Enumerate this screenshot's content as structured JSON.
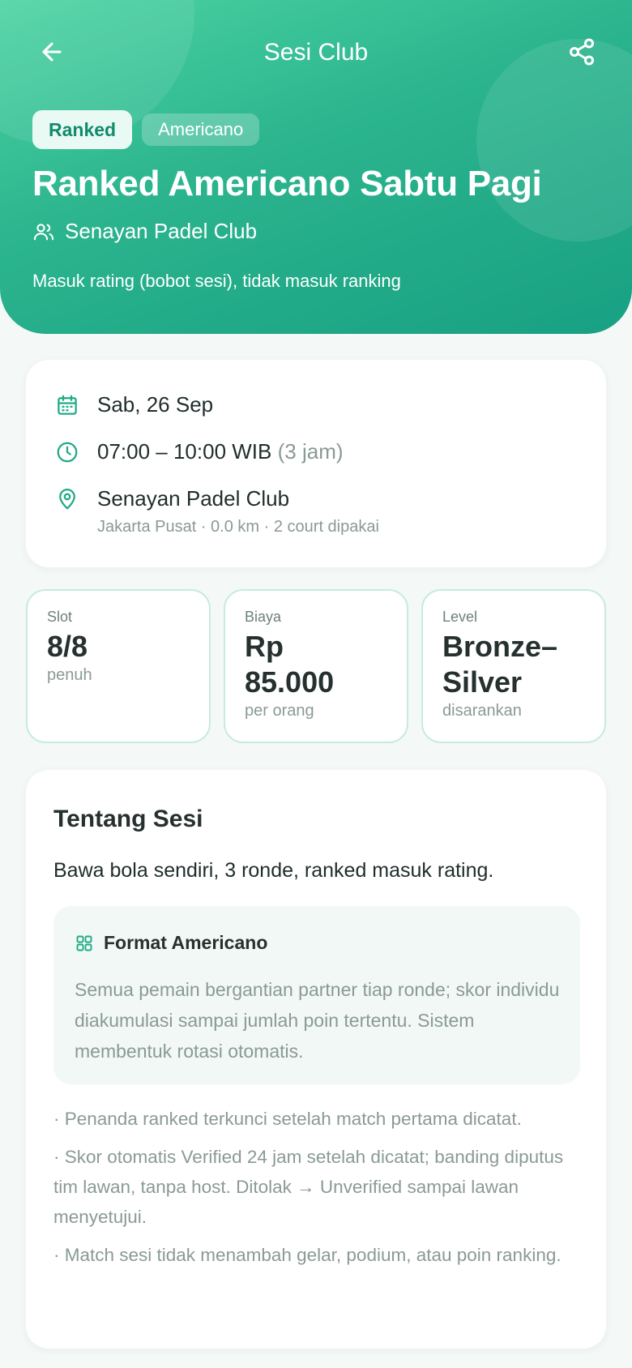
{
  "header": {
    "title": "Sesi Club",
    "badges": {
      "ranked": "Ranked",
      "format": "Americano"
    },
    "session_title": "Ranked Americano Sabtu Pagi",
    "club_name": "Senayan Padel Club",
    "rating_note": "Masuk rating (bobot sesi), tidak masuk ranking"
  },
  "details": {
    "date": "Sab, 26 Sep",
    "time": "07:00 – 10:00 WIB",
    "duration": "(3 jam)",
    "venue": "Senayan Padel Club",
    "venue_sub": "Jakarta Pusat · 0.0 km · 2 court dipakai"
  },
  "stats": {
    "slot": {
      "label": "Slot",
      "value": "8/8",
      "sub": "penuh"
    },
    "cost": {
      "label": "Biaya",
      "value_line1": "Rp",
      "value_line2": "85.000",
      "sub": "per orang"
    },
    "level": {
      "label": "Level",
      "value_line1": "Bronze–",
      "value_line2": "Silver",
      "sub": "disarankan"
    }
  },
  "about": {
    "title": "Tentang Sesi",
    "description": "Bawa bola sendiri, 3 ronde, ranked masuk rating.",
    "format_title": "Format Americano",
    "format_body": "Semua pemain bergantian partner tiap ronde; skor individu diakumulasi sampai jumlah poin tertentu. Sistem membentuk rotasi otomatis.",
    "notes": [
      "· Penanda ranked terkunci setelah match pertama dicatat.",
      "· Skor otomatis Verified 24 jam setelah dicatat; banding diputus tim lawan, tanpa host. Ditolak → Unverified sampai lawan menyetujui.",
      "· Match sesi tidak menambah gelar, podium, atau poin ranking."
    ]
  },
  "colors": {
    "accent": "#1faa85",
    "hero_start": "#4cd3a3",
    "hero_end": "#18a083"
  },
  "icons": [
    "arrow-left-icon",
    "share-icon",
    "users-icon",
    "calendar-icon",
    "clock-icon",
    "map-pin-icon",
    "grid-icon"
  ]
}
